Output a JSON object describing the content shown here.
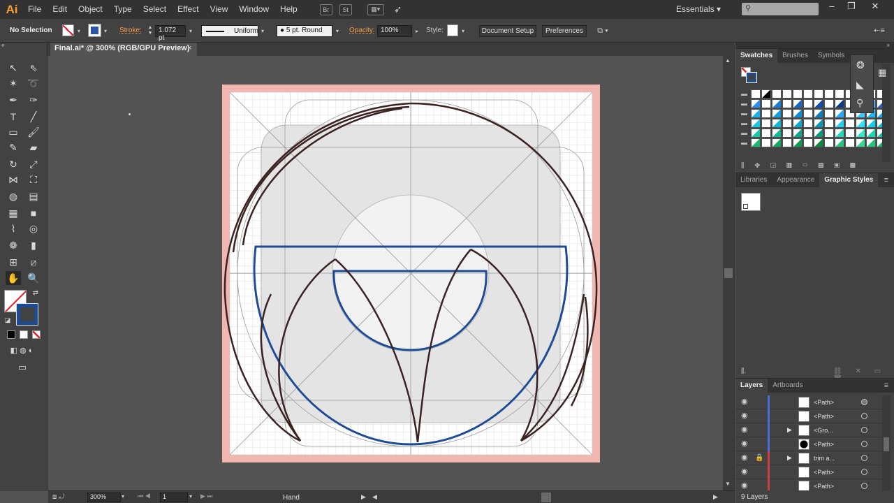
{
  "app": {
    "logo": "Ai"
  },
  "menu": [
    "File",
    "Edit",
    "Object",
    "Type",
    "Select",
    "Effect",
    "View",
    "Window",
    "Help"
  ],
  "menubar_icons": {
    "br": "Br",
    "st": "St"
  },
  "workspace": {
    "label": "Essentials"
  },
  "controlbar": {
    "selection": "No Selection",
    "stroke_label": "Stroke:",
    "stroke_weight": "1.072 pt",
    "stroke_profile": "Uniform",
    "brush": "5 pt. Round",
    "opacity_label": "Opacity:",
    "opacity": "100%",
    "style_label": "Style:",
    "document_setup": "Document Setup",
    "preferences": "Preferences"
  },
  "document": {
    "tab_title": "Final.ai* @ 300% (RGB/GPU Preview)",
    "close": "×"
  },
  "statusbar": {
    "zoom": "300%",
    "artboard": "1",
    "tool": "Hand"
  },
  "swatches_panel": {
    "tabs": [
      "Swatches",
      "Brushes",
      "Symbols"
    ]
  },
  "styles_panel": {
    "tabs": [
      "Libraries",
      "Appearance",
      "Graphic Styles"
    ]
  },
  "layers_panel": {
    "tabs": [
      "Layers",
      "Artboards"
    ],
    "footer": "9 Layers",
    "rows": [
      {
        "name": "<Path>"
      },
      {
        "name": "<Path>"
      },
      {
        "name": "<Gro..."
      },
      {
        "name": "<Path>"
      },
      {
        "name": "trim a..."
      },
      {
        "name": "<Path>"
      },
      {
        "name": "<Path>"
      }
    ]
  },
  "colors": {
    "artboard_bleed": "#f2b6b1",
    "grid": "#d7d7d7",
    "blue_stroke": "#1e4b96",
    "brown_stroke": "#3a2222",
    "accent": "#f7a030"
  }
}
